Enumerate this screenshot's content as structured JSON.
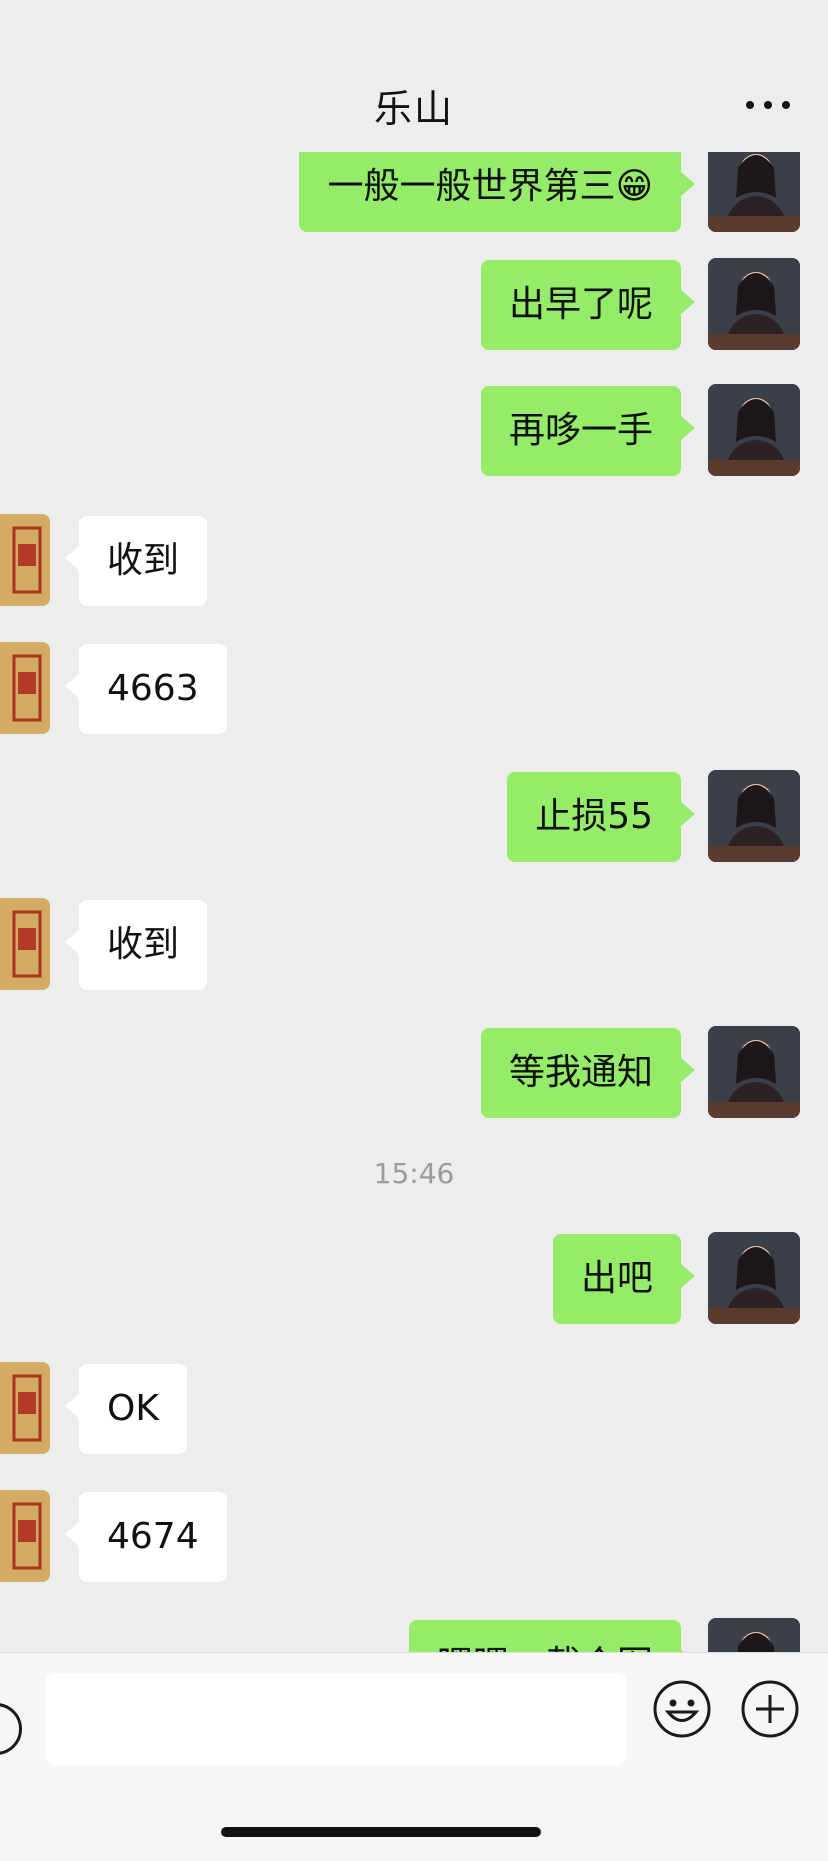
{
  "header": {
    "title": "乐山",
    "more_icon": "more-dots-icon"
  },
  "messages": [
    {
      "side": "me",
      "text": "一般一般世界第三😁"
    },
    {
      "side": "me",
      "text": "出早了呢"
    },
    {
      "side": "me",
      "text": "再哆一手"
    },
    {
      "side": "them",
      "text": "收到"
    },
    {
      "side": "them",
      "text": "4663"
    },
    {
      "side": "me",
      "text": "止损55"
    },
    {
      "side": "them",
      "text": "收到"
    },
    {
      "side": "me",
      "text": "等我通知"
    },
    {
      "type": "timestamp",
      "text": "15:46"
    },
    {
      "side": "me",
      "text": "出吧"
    },
    {
      "side": "them",
      "text": "OK"
    },
    {
      "side": "them",
      "text": "4674"
    },
    {
      "side": "me",
      "text": "嘿嘿，截个图"
    }
  ],
  "input": {
    "value": "",
    "placeholder": ""
  },
  "icons": {
    "voice": "voice-icon",
    "emoji": "emoji-icon",
    "plus": "plus-icon"
  },
  "colors": {
    "my_bubble": "#95ec69",
    "their_bubble": "#ffffff",
    "background": "#ededed"
  }
}
